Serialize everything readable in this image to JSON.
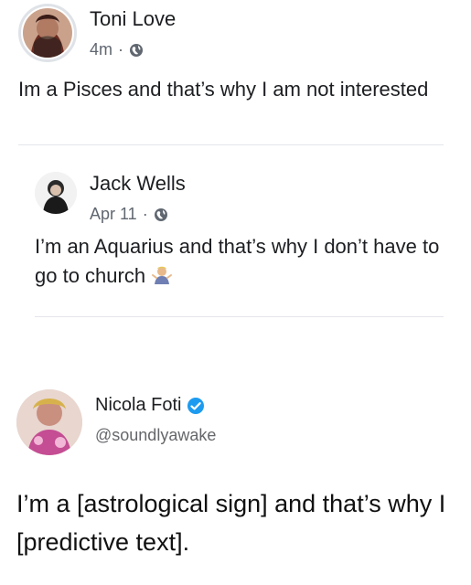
{
  "posts": [
    {
      "author": "Toni Love",
      "time": "4m",
      "separator": "·",
      "privacy_icon": "globe-icon",
      "text": "Im a Pisces and that’s why I am not interested"
    },
    {
      "author": "Jack Wells",
      "time": "Apr 11",
      "separator": "·",
      "privacy_icon": "globe-icon",
      "text": "I’m an Aquarius and that’s why I don’t have to go to church",
      "emoji": "person-shrugging-emoji"
    },
    {
      "author": "Nicola Foti",
      "verified_icon": "verified-badge-icon",
      "handle": "@soundlyawake",
      "text": "I’m a [astrological sign] and that’s why I [predictive text]."
    }
  ],
  "colors": {
    "text": "#1c1e21",
    "muted": "#606770",
    "divider": "#e4e6eb",
    "verified": "#1d9bf0"
  }
}
